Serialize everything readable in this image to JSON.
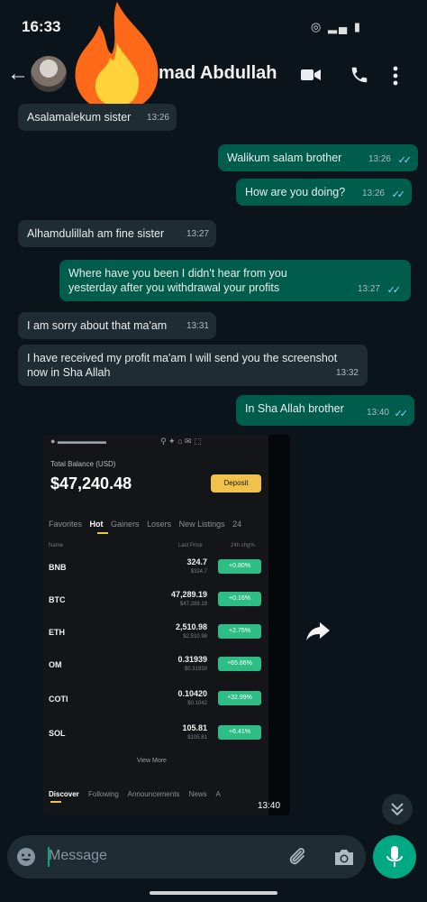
{
  "status_bar": {
    "time": "16:33"
  },
  "header": {
    "contact_name": "mad Abdullah"
  },
  "messages": [
    {
      "direction": "in",
      "text": "Asalamalekum sister",
      "time": "13:26"
    },
    {
      "direction": "out",
      "text": "Walikum salam brother",
      "time": "13:26"
    },
    {
      "direction": "out",
      "text": "How are you doing?",
      "time": "13:26"
    },
    {
      "direction": "in",
      "text": "Alhamdulillah am fine sister",
      "time": "13:27"
    },
    {
      "direction": "out",
      "text": "Where have you been I didn't hear from you yesterday after you withdrawal your profits",
      "time": "13:27"
    },
    {
      "direction": "in",
      "text": "I am sorry about that ma'am",
      "time": "13:31"
    },
    {
      "direction": "in",
      "text": "I have received my profit ma'am I will send you the screenshot now in Sha Allah",
      "time": "13:32"
    },
    {
      "direction": "out",
      "text": "In Sha Allah brother",
      "time": "13:40"
    }
  ],
  "image_message": {
    "time": "13:40",
    "balance_label": "Total Balance (USD)",
    "balance": "$47,240.48",
    "deposit_label": "Deposit",
    "tabs": [
      "Favorites",
      "Hot",
      "Gainers",
      "Losers",
      "New Listings",
      "24"
    ],
    "column_headers": {
      "name": "Name",
      "last_price": "Last Price",
      "change": "24h chg%"
    },
    "rows": [
      {
        "symbol": "BNB",
        "price": "324.7",
        "sub": "$324.7",
        "change": "+0.80%"
      },
      {
        "symbol": "BTC",
        "price": "47,289.19",
        "sub": "$47,289.19",
        "change": "+0.16%"
      },
      {
        "symbol": "ETH",
        "price": "2,510.98",
        "sub": "$2,510.98",
        "change": "+2.75%"
      },
      {
        "symbol": "OM",
        "price": "0.31939",
        "sub": "$0.31939",
        "change": "+65.86%"
      },
      {
        "symbol": "COTI",
        "price": "0.10420",
        "sub": "$0.1042",
        "change": "+32.99%"
      },
      {
        "symbol": "SOL",
        "price": "105.81",
        "sub": "$105.81",
        "change": "+6.41%"
      }
    ],
    "view_more": "View More",
    "bottom_tabs": [
      "Discover",
      "Following",
      "Announcements",
      "News",
      "A"
    ]
  },
  "composer": {
    "placeholder": "Message"
  },
  "colors": {
    "background": "#0b141a",
    "incoming_bubble": "#1f2c33",
    "outgoing_bubble": "#005c4b",
    "accent": "#00a884",
    "read_ticks": "#8fd0ff"
  }
}
